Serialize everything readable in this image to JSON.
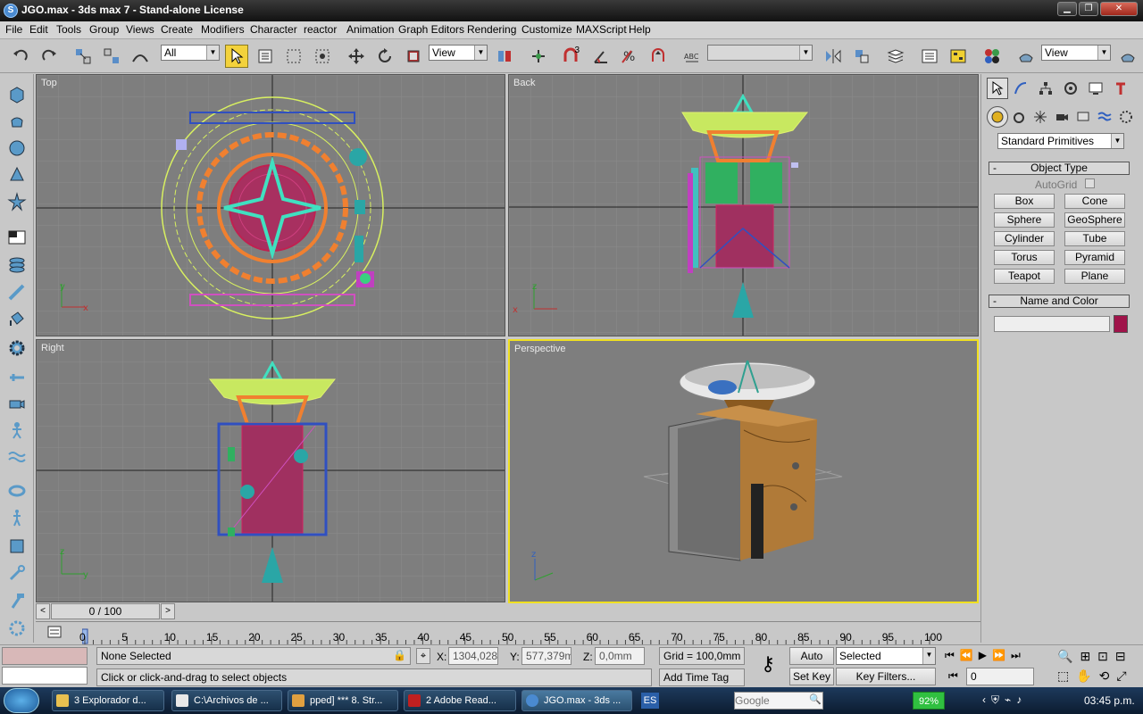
{
  "window": {
    "title": "JGO.max - 3ds max 7  - Stand-alone License",
    "icon": "3ds-max-icon",
    "controls": [
      "minimize-icon",
      "restore-icon",
      "close-icon"
    ]
  },
  "menu": [
    "File",
    "Edit",
    "Tools",
    "Group",
    "Views",
    "Create",
    "Modifiers",
    "Character",
    "reactor",
    "Animation",
    "Graph Editors",
    "Rendering",
    "Customize",
    "MAXScript",
    "Help"
  ],
  "toolbar": {
    "selection_filter": "All",
    "ref_coord_system": "View",
    "named_selection": "",
    "view_dropdown_right": "View",
    "snap_label": "3"
  },
  "viewports": {
    "top": "Top",
    "back": "Back",
    "right": "Right",
    "perspective": "Perspective"
  },
  "command_panel": {
    "category_dropdown": "Standard Primitives",
    "object_type_header": "Object Type",
    "autogrid_label": "AutoGrid",
    "buttons": [
      "Box",
      "Cone",
      "Sphere",
      "GeoSphere",
      "Cylinder",
      "Tube",
      "Torus",
      "Pyramid",
      "Teapot",
      "Plane"
    ],
    "name_color_header": "Name and Color",
    "name_value": "",
    "object_color": "#a0144a"
  },
  "timeline": {
    "slider_label": "0 / 100",
    "ticks": [
      "0",
      "5",
      "10",
      "15",
      "20",
      "25",
      "30",
      "35",
      "40",
      "45",
      "50",
      "55",
      "60",
      "65",
      "70",
      "75",
      "80",
      "85",
      "90",
      "95",
      "100"
    ]
  },
  "status": {
    "selection": "None Selected",
    "prompt": "Click or click-and-drag to select objects",
    "x_label": "X:",
    "x_value": "1304,028m",
    "y_label": "Y:",
    "y_value": "577,379mn",
    "z_label": "Z:",
    "z_value": "0,0mm",
    "grid": "Grid = 100,0mm",
    "add_time_tag": "Add Time Tag",
    "auto_key": "Auto Key",
    "set_key": "Set Key",
    "key_mode": "Selected",
    "key_filters": "Key Filters...",
    "frame_value": "0"
  },
  "taskbar": {
    "tasks": [
      "3 Explorador d...",
      "C:\\Archivos de ...",
      "pped] *** 8. Str...",
      "2 Adobe Read...",
      "JGO.max - 3ds ..."
    ],
    "language": "ES",
    "battery": "92%",
    "clock": "03:45 p.m.",
    "search_placeholder": "Google"
  },
  "colors": {
    "active_viewport": "#f0e020",
    "title_bar": "#222222",
    "viewport_bg": "#7e7e7e",
    "taskbar": "#1a3350"
  }
}
